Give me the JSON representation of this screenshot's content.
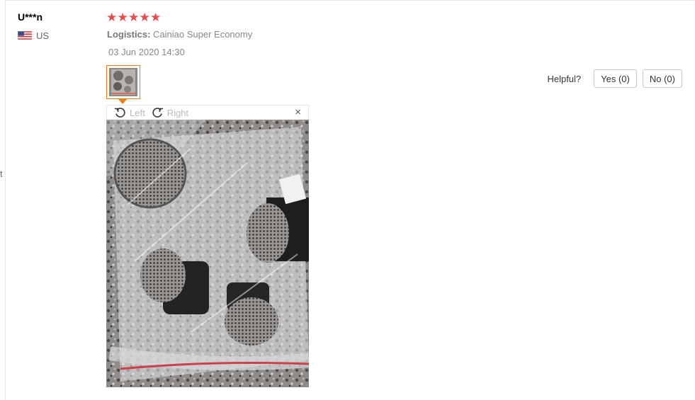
{
  "review": {
    "username": "U***n",
    "country": "US",
    "rating": 5,
    "star_color": "#e94b4b",
    "logistics_label": "Logistics:",
    "logistics_value": "Cainiao Super Economy",
    "date": "03 Jun 2020 14:30"
  },
  "viewer": {
    "rotate_left_label": "Left",
    "rotate_right_label": "Right",
    "close_label": "×",
    "accent_color": "#f07d12"
  },
  "helpful": {
    "label": "Helpful?",
    "yes_label": "Yes (0)",
    "no_label": "No (0)"
  },
  "page": {
    "edge_char": "t"
  }
}
